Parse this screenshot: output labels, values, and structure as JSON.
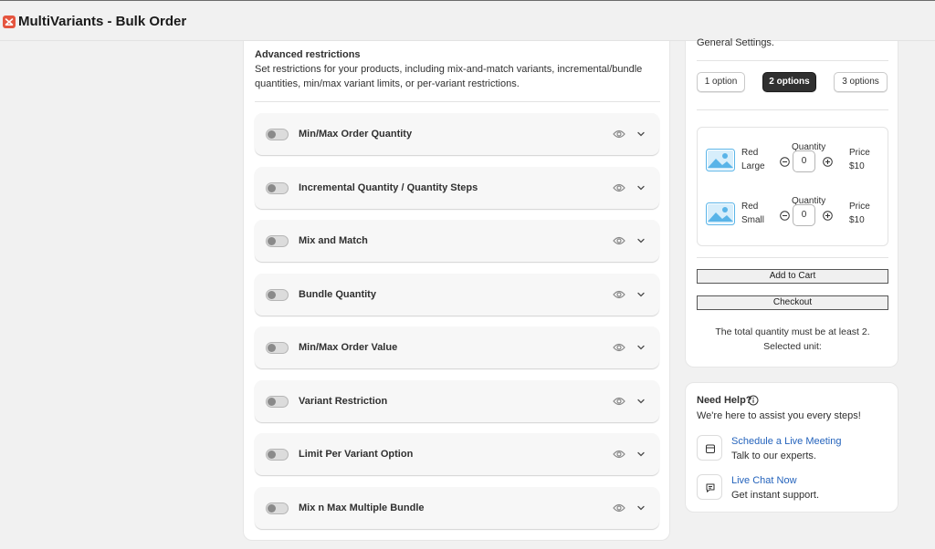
{
  "app": {
    "title": "MultiVariants - Bulk Order"
  },
  "restrictions": {
    "heading": "Advanced restrictions",
    "description": "Set restrictions for your products, including mix-and-match variants, incremental/bundle quantities, min/max variant limits, or per-variant restrictions.",
    "rules": [
      {
        "label": "Min/Max Order Quantity",
        "enabled": false
      },
      {
        "label": "Incremental Quantity / Quantity Steps",
        "enabled": false
      },
      {
        "label": "Mix and Match",
        "enabled": false
      },
      {
        "label": "Bundle Quantity",
        "enabled": false
      },
      {
        "label": "Min/Max Order Value",
        "enabled": false
      },
      {
        "label": "Variant Restriction",
        "enabled": false
      },
      {
        "label": "Limit Per Variant Option",
        "enabled": false
      },
      {
        "label": "Mix n Max Multiple Bundle",
        "enabled": false
      }
    ]
  },
  "preview": {
    "general_settings_text": "General Settings.",
    "options": [
      "1 option",
      "2 options",
      "3 options"
    ],
    "selected_option": "2 options",
    "variants": [
      {
        "color": "Red",
        "size": "Large",
        "quantity_label": "Quantity",
        "quantity": "0",
        "price_label": "Price",
        "price": "$10"
      },
      {
        "color": "Red",
        "size": "Small",
        "quantity_label": "Quantity",
        "quantity": "0",
        "price_label": "Price",
        "price": "$10"
      }
    ],
    "add_to_cart": "Add to Cart",
    "checkout": "Checkout",
    "note_line1": "The total quantity must be at least 2.",
    "note_line2": "Selected unit:"
  },
  "help": {
    "title": "Need Help?",
    "subtitle": "We're here to assist you every steps!",
    "items": [
      {
        "link": "Schedule a Live Meeting",
        "desc": "Talk to our experts.",
        "icon": "calendar-icon"
      },
      {
        "link": "Live Chat Now",
        "desc": "Get instant support.",
        "icon": "chat-icon"
      }
    ]
  },
  "colors": {
    "accent_link": "#2463bc",
    "active_option_bg": "#303030",
    "logo": "#e5553f"
  }
}
